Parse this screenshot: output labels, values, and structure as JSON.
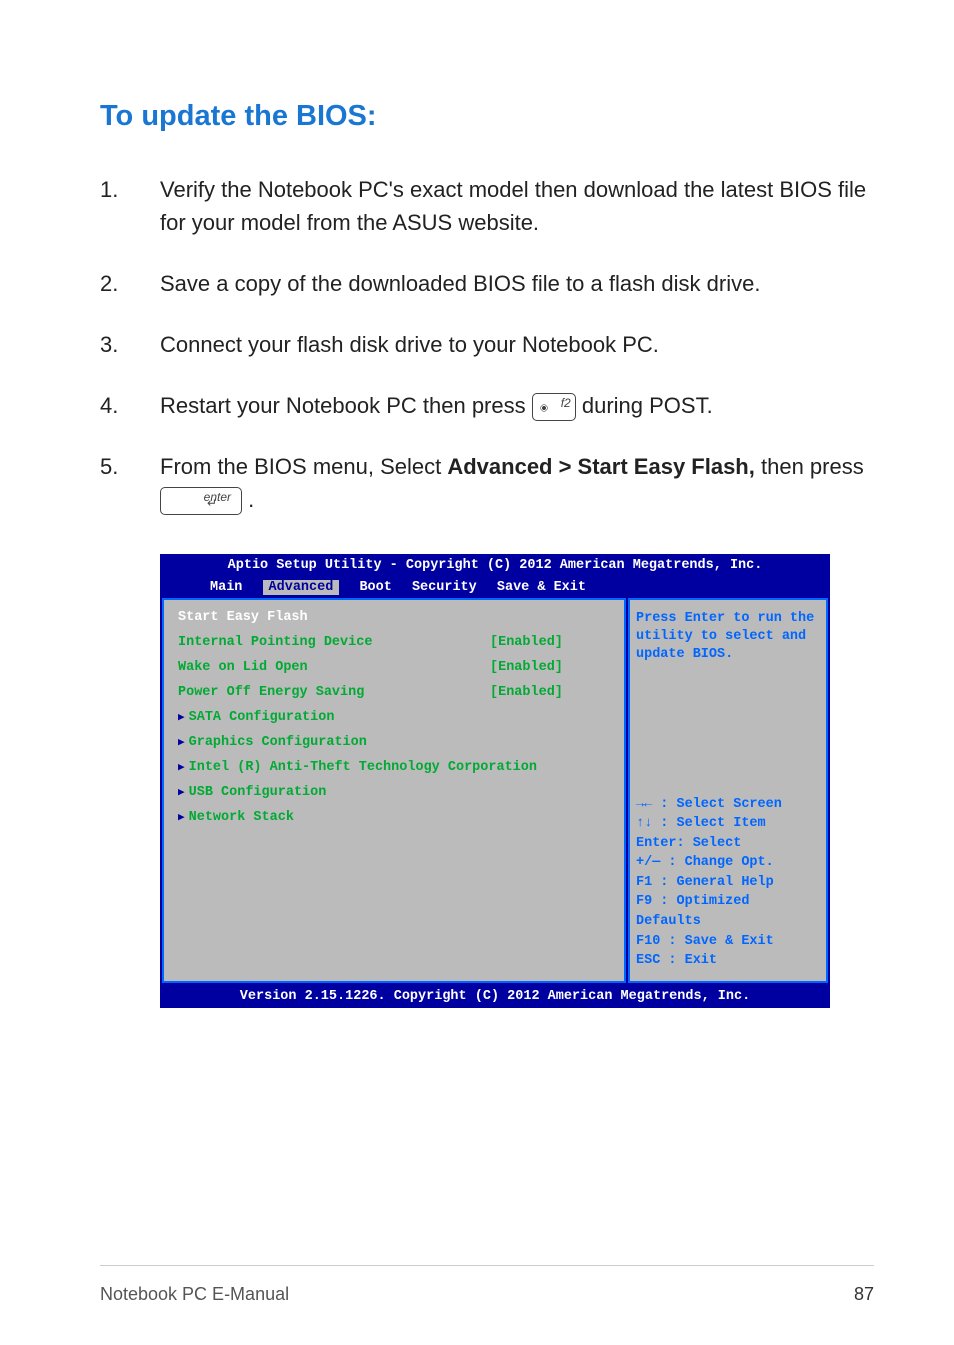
{
  "heading": "To update the BIOS:",
  "steps": {
    "1": {
      "num": "1.",
      "text": "Verify the Notebook PC's exact model then download the latest BIOS file for your model from the ASUS website."
    },
    "2": {
      "num": "2.",
      "text": "Save a copy of the downloaded BIOS file to a flash disk drive."
    },
    "3": {
      "num": "3.",
      "text": "Connect your flash disk drive to your Notebook PC."
    },
    "4": {
      "num": "4.",
      "pre": "Restart your Notebook PC then press ",
      "key": "f2",
      "post": " during POST."
    },
    "5": {
      "num": "5.",
      "pre": "From the BIOS menu, Select ",
      "bold": "Advanced > Start Easy Flash,",
      "mid": " then press ",
      "key": "enter",
      "post": "."
    }
  },
  "bios": {
    "header": "Aptio Setup Utility - Copyright (C) 2012 American Megatrends, Inc.",
    "tabs": {
      "main": "Main",
      "advanced": "Advanced",
      "boot": "Boot",
      "security": "Security",
      "save": "Save & Exit"
    },
    "left": {
      "start_easy_flash": "Start Easy Flash",
      "ipd_label": "Internal Pointing Device",
      "ipd_val": "[Enabled]",
      "wake_label": "Wake on Lid Open",
      "wake_val": "[Enabled]",
      "power_label": "Power Off Energy Saving",
      "power_val": "[Enabled]",
      "sata": "SATA Configuration",
      "gfx": "Graphics Configuration",
      "intel": "Intel (R) Anti-Theft Technology Corporation",
      "usb": "USB Configuration",
      "net": "Network Stack"
    },
    "right": {
      "help": "Press Enter to run the utility to select and update BIOS.",
      "k1": "→←  : Select Screen",
      "k2": "↑↓  : Select Item",
      "k3": "Enter: Select",
      "k4": "+/—  : Change Opt.",
      "k5": "F1  : General Help",
      "k6": "F9  : Optimized Defaults",
      "k7": "F10 : Save & Exit",
      "k8": "ESC : Exit"
    },
    "footer": "Version 2.15.1226. Copyright (C) 2012 American Megatrends, Inc."
  },
  "footer": {
    "left": "Notebook PC E-Manual",
    "page": "87"
  },
  "keylabels": {
    "f2": "f2",
    "enter": "enter"
  }
}
